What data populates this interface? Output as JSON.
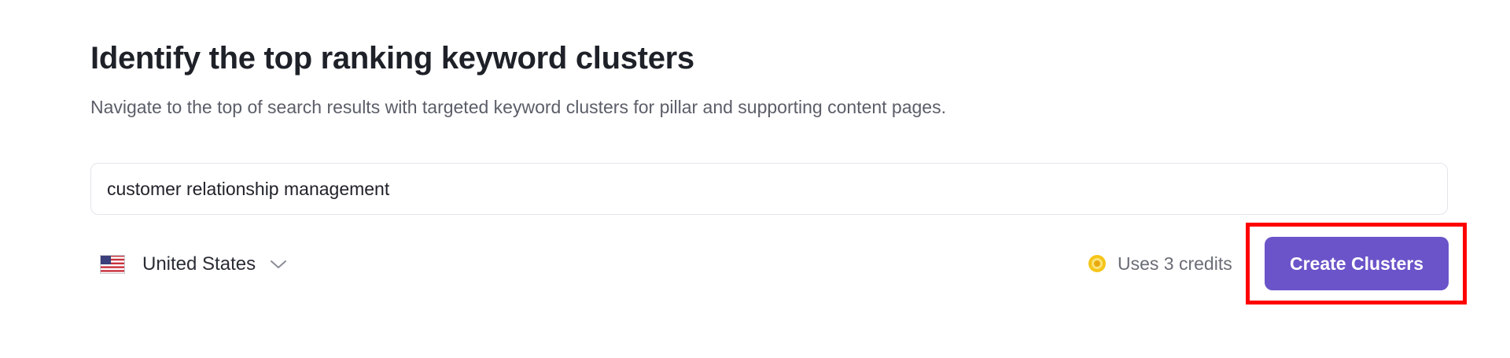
{
  "header": {
    "title": "Identify the top ranking keyword clusters",
    "subtitle": "Navigate to the top of search results with targeted keyword clusters for pillar and supporting content pages."
  },
  "search": {
    "value": "customer relationship management",
    "placeholder": ""
  },
  "country": {
    "selected": "United States",
    "flag_icon": "us-flag-icon",
    "dropdown_icon": "chevron-down-icon"
  },
  "credits": {
    "icon": "coin-icon",
    "label": "Uses 3 credits"
  },
  "actions": {
    "create_label": "Create Clusters"
  },
  "colors": {
    "accent": "#6b54c9",
    "highlight": "#ff0000",
    "coin": "#f5c518"
  }
}
